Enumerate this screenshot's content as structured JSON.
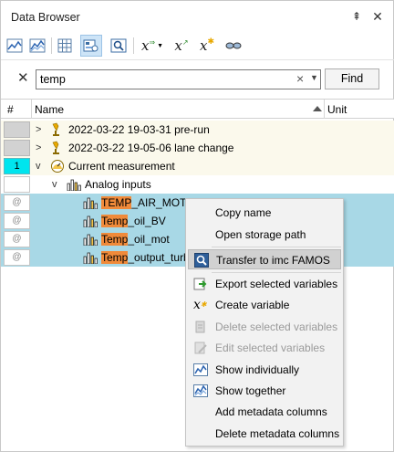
{
  "window": {
    "title": "Data Browser",
    "pin_glyph": "⇞",
    "close_glyph": "✕"
  },
  "toolbar": {
    "buttons": [
      {
        "icon": "chart-line-icon"
      },
      {
        "icon": "chart-area-icon"
      },
      {
        "icon": "grid-icon"
      },
      {
        "icon": "browse-view-icon",
        "active": true
      },
      {
        "icon": "search-zoom-icon"
      },
      {
        "icon": "variable-dropdown-icon"
      },
      {
        "icon": "variable-export-icon"
      },
      {
        "icon": "variable-new-icon"
      },
      {
        "icon": "glasses-icon"
      }
    ]
  },
  "search": {
    "close_glyph": "✕",
    "value": "temp",
    "clear_glyph": "×",
    "dropdown_glyph": "▼",
    "find_label": "Find"
  },
  "table": {
    "headers": {
      "num": "#",
      "name": "Name",
      "unit": "Unit"
    },
    "rows": [
      {
        "num": "",
        "label": "2022-03-22 19-03-31 pre-run",
        "type": "gray",
        "chev": ">"
      },
      {
        "num": "",
        "label": "2022-03-22 19-05-06 lane change",
        "type": "gray",
        "chev": ">"
      },
      {
        "num": "1",
        "label": "Current measurement",
        "type": "cyan",
        "chev": "v"
      },
      {
        "num": "",
        "label": "Analog inputs",
        "type": "plain",
        "chev": "v"
      },
      {
        "num": "@",
        "hl": "TEMP",
        "rest": "_AIR_MOT"
      },
      {
        "num": "@",
        "hl": "Temp",
        "rest": "_oil_BV"
      },
      {
        "num": "@",
        "hl": "Temp",
        "rest": "_oil_mot"
      },
      {
        "num": "@",
        "hl": "Temp",
        "rest": "_output_turbo"
      }
    ]
  },
  "context_menu": {
    "items": [
      {
        "label": "Copy name"
      },
      {
        "label": "Open storage path"
      },
      {
        "label": "Transfer to imc FAMOS",
        "hover": true
      },
      {
        "label": "Export selected variables"
      },
      {
        "label": "Create variable"
      },
      {
        "label": "Delete selected variables",
        "disabled": true
      },
      {
        "label": "Edit selected variables",
        "disabled": true
      },
      {
        "label": "Show individually"
      },
      {
        "label": "Show together"
      },
      {
        "label": "Add metadata columns"
      },
      {
        "label": "Delete metadata columns"
      }
    ]
  },
  "colors": {
    "selected_row": "#a8d8e6",
    "highlight": "#f08a3a",
    "current_measurement_num": "#00e5ee",
    "alt_row": "#fbf9ec"
  }
}
